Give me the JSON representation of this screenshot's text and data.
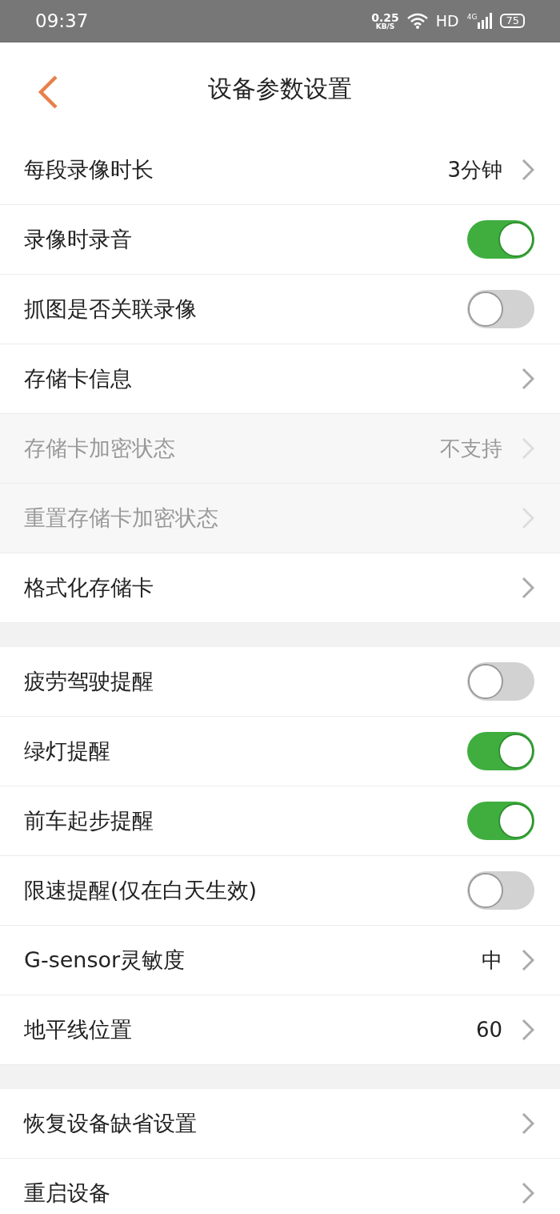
{
  "status_bar": {
    "time": "09:37",
    "net_speed": "0.25",
    "net_unit": "KB/S",
    "hd": "HD",
    "network": "4G",
    "battery": "75"
  },
  "header": {
    "title": "设备参数设置"
  },
  "groups": [
    {
      "rows": [
        {
          "kind": "nav",
          "label": "每段录像时长",
          "value": "3分钟",
          "disabled": false
        },
        {
          "kind": "toggle",
          "label": "录像时录音",
          "on": true
        },
        {
          "kind": "toggle",
          "label": "抓图是否关联录像",
          "on": false
        },
        {
          "kind": "nav",
          "label": "存储卡信息",
          "disabled": false
        },
        {
          "kind": "nav",
          "label": "存储卡加密状态",
          "value": "不支持",
          "disabled": true
        },
        {
          "kind": "nav",
          "label": "重置存储卡加密状态",
          "disabled": true
        },
        {
          "kind": "nav",
          "label": "格式化存储卡",
          "disabled": false
        }
      ]
    },
    {
      "rows": [
        {
          "kind": "toggle",
          "label": "疲劳驾驶提醒",
          "on": false
        },
        {
          "kind": "toggle",
          "label": "绿灯提醒",
          "on": true
        },
        {
          "kind": "toggle",
          "label": "前车起步提醒",
          "on": true
        },
        {
          "kind": "toggle",
          "label": "限速提醒(仅在白天生效)",
          "on": false
        },
        {
          "kind": "nav",
          "label": "G-sensor灵敏度",
          "value": "中",
          "disabled": false
        },
        {
          "kind": "nav",
          "label": "地平线位置",
          "value": "60",
          "disabled": false
        }
      ]
    },
    {
      "rows": [
        {
          "kind": "nav",
          "label": "恢复设备缺省设置",
          "disabled": false
        },
        {
          "kind": "nav",
          "label": "重启设备",
          "disabled": false
        }
      ]
    }
  ]
}
